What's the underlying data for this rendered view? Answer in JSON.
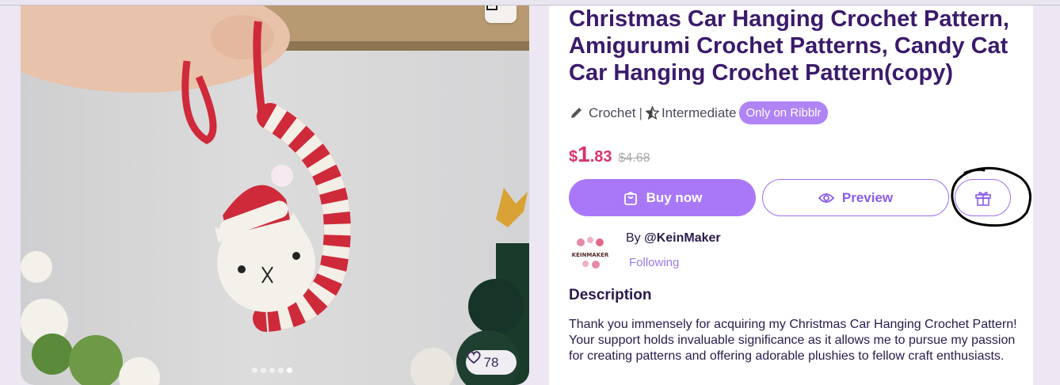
{
  "product": {
    "title": "Christmas Car Hanging Crochet Pattern, Amigurumi Crochet Patterns, Candy Cat Car Hanging Crochet Pattern(copy)",
    "category": "Crochet",
    "separator": "|",
    "level": "Intermediate",
    "badge": "Only on Ribblr",
    "price_dollar": "$",
    "price_whole": "1",
    "price_cents": ".83",
    "price_original": "$4.68",
    "buy_label": "Buy now",
    "preview_label": "Preview",
    "likes": "78",
    "gallery_dot_count": 5,
    "gallery_active_dot": 4
  },
  "author": {
    "prefix": "By ",
    "handle": "@KeinMaker",
    "logo_text": "KEINMAKER",
    "follow_label": "Following"
  },
  "description": {
    "heading": "Description",
    "body": "Thank you immensely for acquiring my Christmas Car Hanging Crochet Pattern! Your support holds invaluable significance as it allows me to pursue my passion for creating patterns and offering adorable plushies to fellow craft enthusiasts."
  },
  "icons": {
    "category": "pencil-icon",
    "level": "star-icon",
    "buy": "bag-icon",
    "preview": "eye-icon",
    "gift": "gift-icon",
    "like": "heart-icon",
    "expand": "expand-icon"
  },
  "colors": {
    "accent": "#a978f8",
    "price": "#d6336c",
    "title": "#3b1a6b",
    "annotation": "#000000"
  }
}
